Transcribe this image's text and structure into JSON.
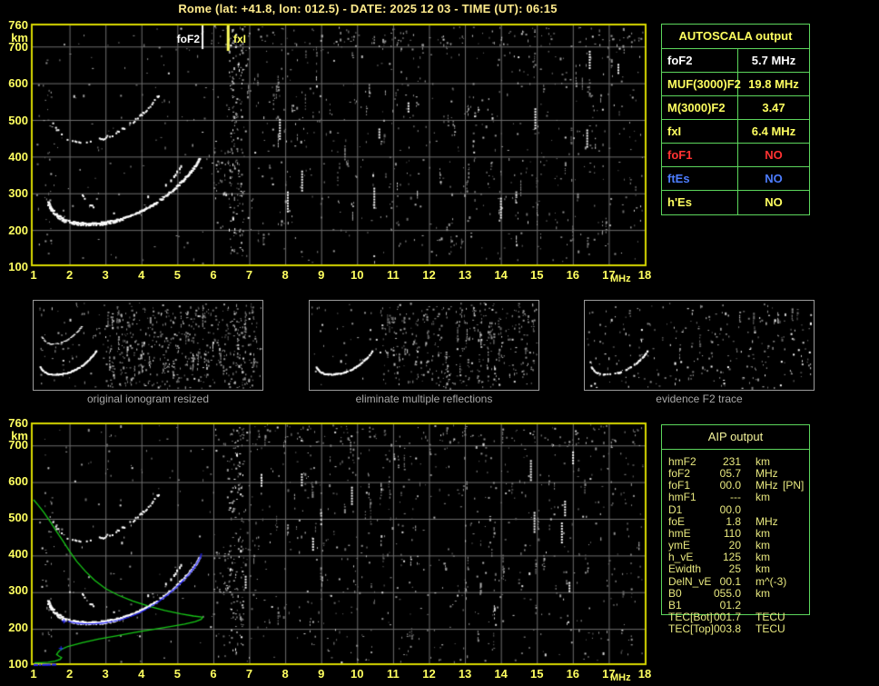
{
  "title": "Rome (lat: +41.8, lon: 012.5) - DATE: 2025 12 03 - TIME (UT): 06:15",
  "colors": {
    "accent_yellow": "#ffff60",
    "frame_yellow": "#d9d900",
    "grid_gray": "#6e6e6e",
    "table_green": "#5cd65c",
    "profile_green": "#17c817",
    "trace_white": "#ffffff",
    "restored_blue": "#2525ff",
    "alert_red": "#ff3232",
    "es_blue": "#4d7dff",
    "caption_gray": "#a8a8a8"
  },
  "top_plot": {
    "y_unit": "km",
    "y_ticks": [
      "760",
      "km",
      "700",
      "600",
      "500",
      "400",
      "300",
      "200",
      "100"
    ],
    "x_ticks": [
      "1",
      "2",
      "3",
      "4",
      "5",
      "6",
      "7",
      "8",
      "9",
      "10",
      "11",
      "12",
      "13",
      "14",
      "15",
      "16",
      "17",
      "18"
    ],
    "x_unit": "MHz",
    "freq_range_mhz": [
      1,
      18
    ],
    "height_range_km": [
      100,
      760
    ],
    "markers": [
      {
        "label": "foF2",
        "freq_mhz": 5.7,
        "color": "#ffffff"
      },
      {
        "label": "fxI",
        "freq_mhz": 6.4,
        "color": "#ffff60"
      }
    ]
  },
  "autoscala": {
    "header": "AUTOSCALA output",
    "rows": [
      {
        "param": "foF2",
        "value": "5.7 MHz",
        "color": "#ffffff"
      },
      {
        "param": "MUF(3000)F2",
        "value": "19.8 MHz",
        "color": "#ffff60"
      },
      {
        "param": "M(3000)F2",
        "value": "3.47",
        "color": "#ffff60"
      },
      {
        "param": "fxI",
        "value": "6.4 MHz",
        "color": "#ffff60"
      },
      {
        "param": "foF1",
        "value": "NO",
        "color": "#ff3232"
      },
      {
        "param": "ftEs",
        "value": "NO",
        "color": "#4d7dff"
      },
      {
        "param": "h'Es",
        "value": "NO",
        "color": "#ffff60"
      }
    ]
  },
  "panels": [
    {
      "caption": "original ionogram resized"
    },
    {
      "caption": "eliminate multiple reflections"
    },
    {
      "caption": "evidence F2 trace"
    }
  ],
  "bottom_plot": {
    "y_unit": "km",
    "y_ticks": [
      "760",
      "km",
      "700",
      "600",
      "500",
      "400",
      "300",
      "200",
      "100"
    ],
    "x_ticks": [
      "1",
      "2",
      "3",
      "4",
      "5",
      "6",
      "7",
      "8",
      "9",
      "10",
      "11",
      "12",
      "13",
      "14",
      "15",
      "16",
      "17",
      "18"
    ],
    "x_unit": "MHz",
    "freq_range_mhz": [
      1,
      18
    ],
    "height_range_km": [
      100,
      760
    ]
  },
  "aip": {
    "header": "AIP output",
    "rows": [
      {
        "param": "hmF2",
        "value": "231",
        "unit": "km",
        "note": ""
      },
      {
        "param": "foF2",
        "value": "05.7",
        "unit": "MHz",
        "note": ""
      },
      {
        "param": "foF1",
        "value": "00.0",
        "unit": "MHz",
        "note": "[PN]"
      },
      {
        "param": "hmF1",
        "value": "---",
        "unit": "km",
        "note": ""
      },
      {
        "param": "D1",
        "value": "00.0",
        "unit": "",
        "note": ""
      },
      {
        "param": "foE",
        "value": "1.8",
        "unit": "MHz",
        "note": ""
      },
      {
        "param": "hmE",
        "value": "110",
        "unit": "km",
        "note": ""
      },
      {
        "param": "ymE",
        "value": "20",
        "unit": "km",
        "note": ""
      },
      {
        "param": "h_vE",
        "value": "125",
        "unit": "km",
        "note": ""
      },
      {
        "param": "Ewidth",
        "value": "25",
        "unit": "km",
        "note": ""
      },
      {
        "param": "DelN_vE",
        "value": "00.1",
        "unit": "m^(-3)",
        "note": ""
      },
      {
        "param": "B0",
        "value": "055.0",
        "unit": "km",
        "note": ""
      },
      {
        "param": "B1",
        "value": "01.2",
        "unit": "",
        "note": ""
      },
      {
        "param": "TEC[Bot]",
        "value": "001.7",
        "unit": "TECU",
        "note": ""
      },
      {
        "param": "TEC[Top]",
        "value": "003.8",
        "unit": "TECU",
        "note": ""
      }
    ]
  }
}
